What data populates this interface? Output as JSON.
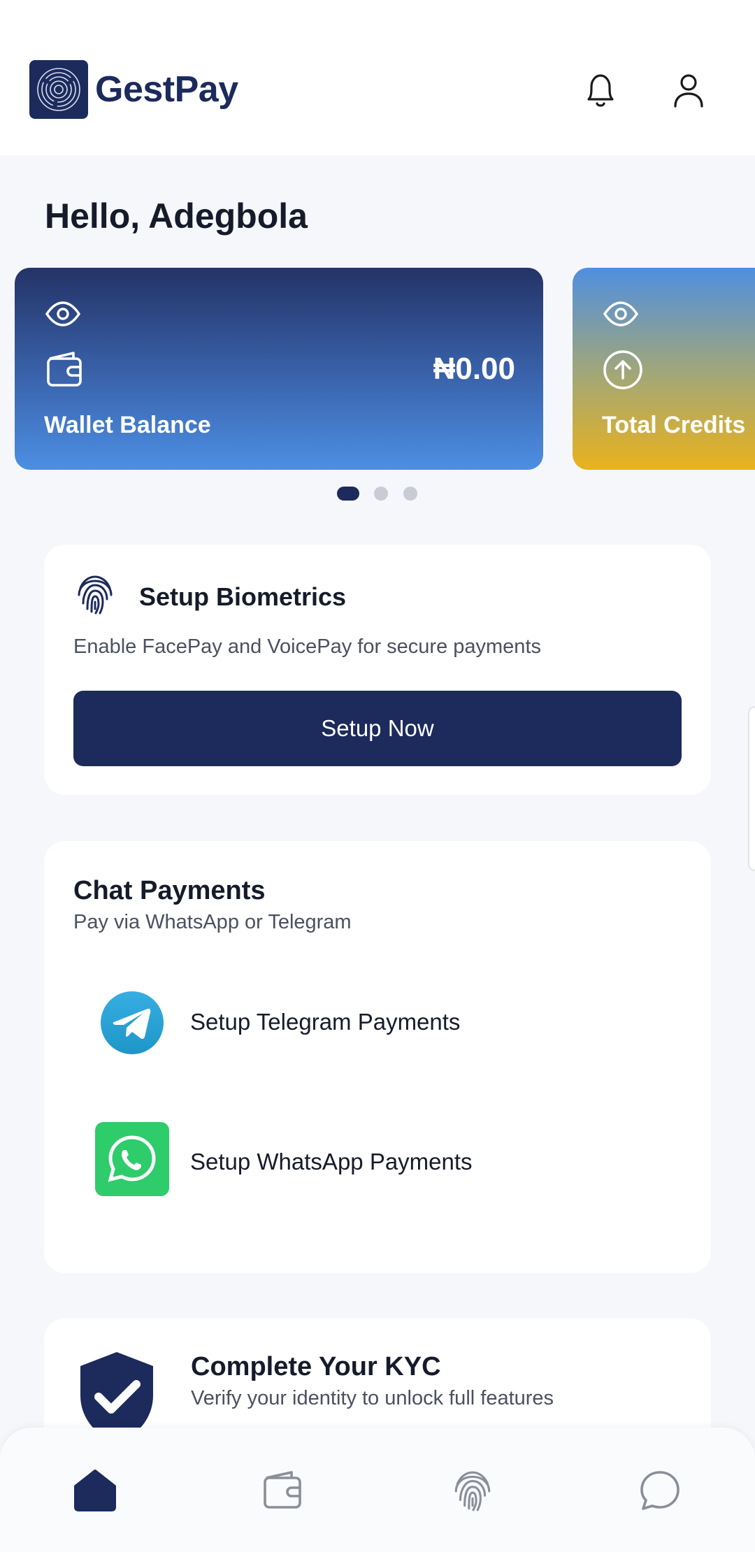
{
  "header": {
    "brand": "GestPay",
    "icons": [
      "notification-bell-icon",
      "profile-user-icon"
    ],
    "brand_color": "#1c2a5c"
  },
  "greeting": "Hello, Adegbola",
  "balance_cards": [
    {
      "label": "Wallet Balance",
      "amount": "₦0.00",
      "icon": "wallet-icon"
    },
    {
      "label": "Total Credits",
      "icon": "arrow-up-circle-icon"
    }
  ],
  "carousel": {
    "count": 3,
    "active_index": 0
  },
  "biometrics": {
    "title": "Setup Biometrics",
    "subtitle": "Enable FacePay and VoicePay for secure payments",
    "button_label": "Setup Now"
  },
  "chat_payments": {
    "title": "Chat Payments",
    "subtitle": "Pay via WhatsApp or Telegram",
    "items": [
      {
        "label": "Setup Telegram Payments",
        "icon": "telegram-icon",
        "color": "#2aa3df"
      },
      {
        "label": "Setup WhatsApp Payments",
        "icon": "whatsapp-icon",
        "color": "#2ecc6a"
      }
    ]
  },
  "kyc": {
    "title": "Complete Your KYC",
    "subtitle": "Verify your identity to unlock full features"
  },
  "bottom_nav": {
    "items": [
      "home-icon",
      "wallet-icon",
      "fingerprint-icon",
      "chat-icon"
    ],
    "active": "home-icon"
  }
}
